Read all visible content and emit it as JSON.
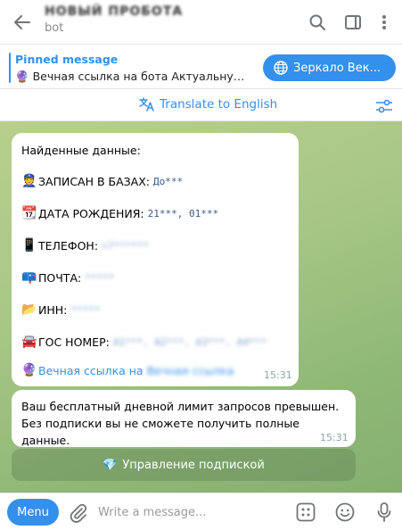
{
  "header": {
    "title": "НОВЫЙ ПРОБОТА",
    "subtitle": "bot"
  },
  "pinned": {
    "label": "Pinned message",
    "text": "Вечная ссылка на бота  Актуальную с...",
    "button_label": "Зеркало Век..."
  },
  "translate": {
    "label": "Translate to English"
  },
  "message1": {
    "heading": "Найденные данные:",
    "rows": [
      {
        "emoji": "👮",
        "label": "ЗАПИСАН В БАЗАХ:",
        "value": "До***"
      },
      {
        "emoji": "📆",
        "label": "ДАТА РОЖДЕНИЯ:",
        "value": "21***, 01***"
      },
      {
        "emoji": "📱",
        "label": "ТЕЛЕФОН:",
        "value": "+7******"
      },
      {
        "emoji": "📪",
        "label": "ПОЧТА:",
        "value": "*****"
      },
      {
        "emoji": "📂",
        "label": "ИНН:",
        "value": "*****"
      },
      {
        "emoji": "🚘",
        "label": "ГОС НОМЕР:",
        "value": "A1***, A2***, A3***, A4***"
      }
    ],
    "link_prefix": "Вечная ссылка на",
    "link_target": "Вечная ссылка",
    "time": "15:31"
  },
  "message2": {
    "line1": "Ваш бесплатный дневной лимит запросов превышен.",
    "line2": "Без подписки вы не сможете получить полные данные.",
    "time": "15:31"
  },
  "inline_button": {
    "label": "Управление подпиской"
  },
  "composer": {
    "menu_label": "Menu",
    "placeholder": "Write a message..."
  },
  "colors": {
    "accent": "#3390ec",
    "chat_bg": "#a8c785"
  }
}
